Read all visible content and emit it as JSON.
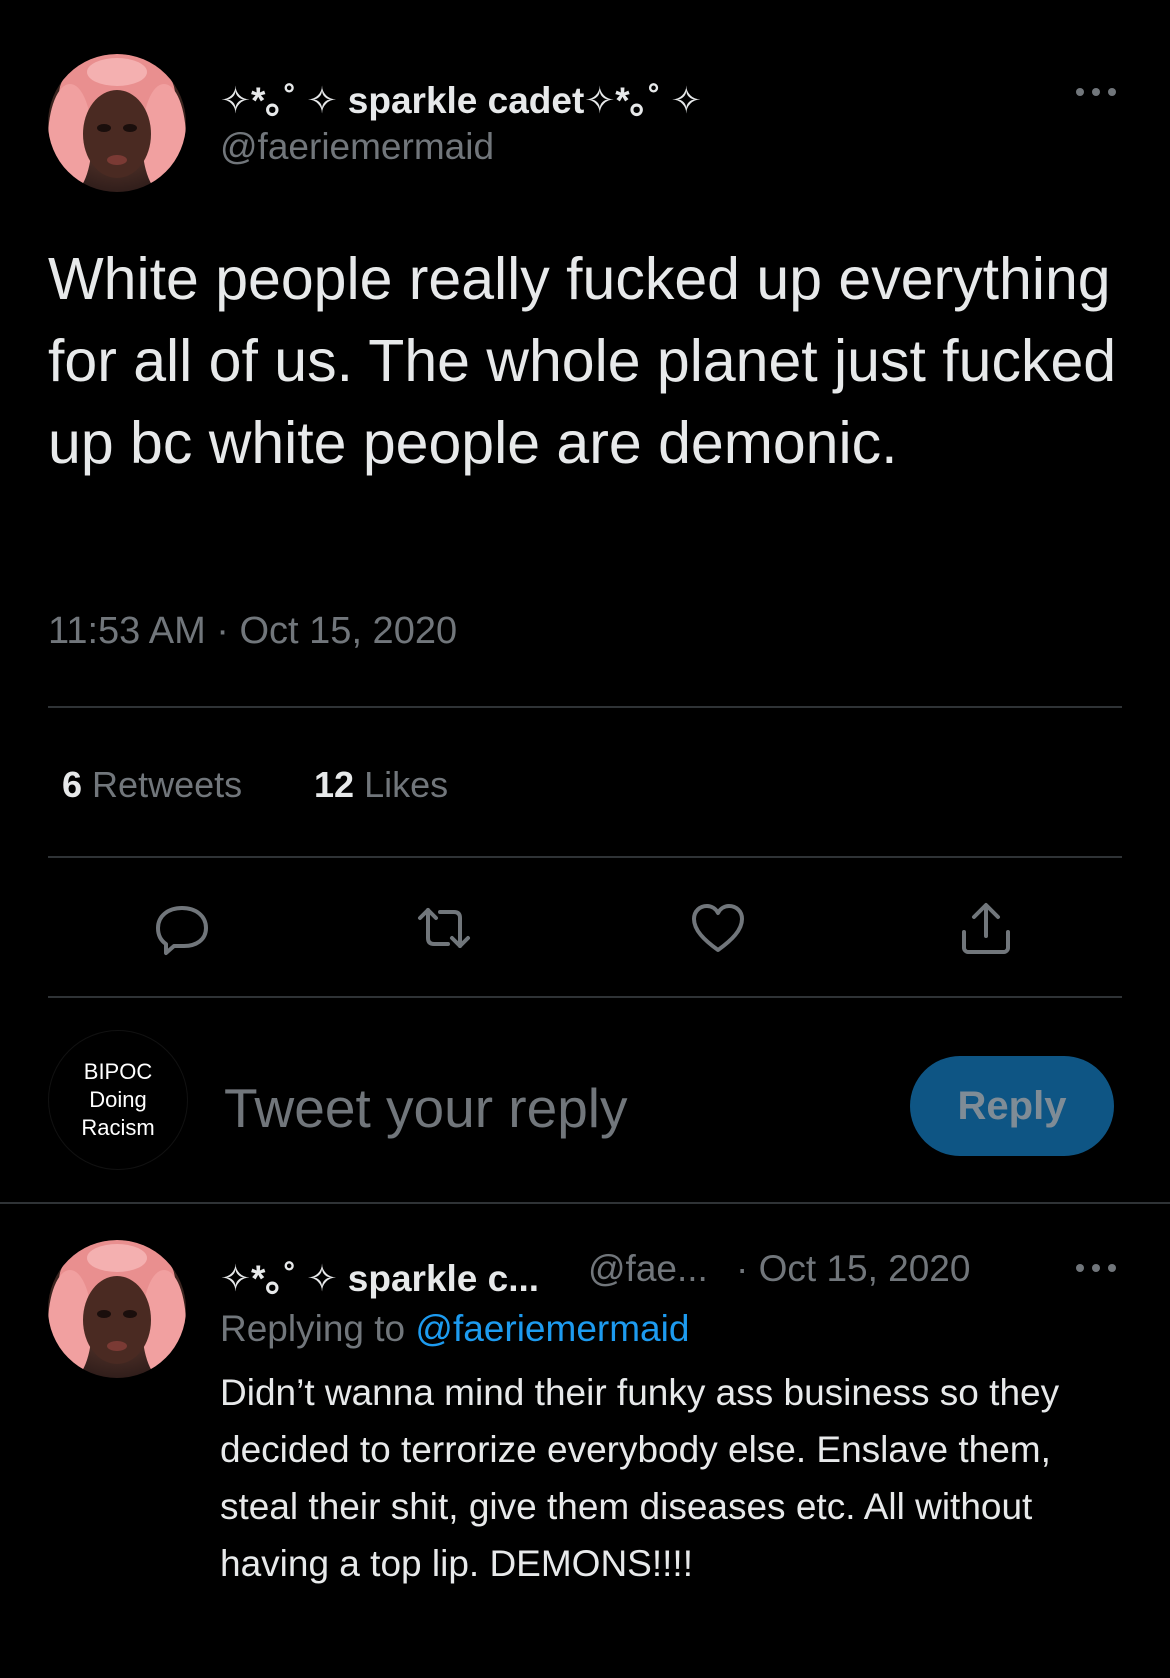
{
  "main_tweet": {
    "display_name": "✧*｡˚ ✧ sparkle cadet✧*｡˚ ✧",
    "handle": "@faeriemermaid",
    "text": "White people really fucked up everything for all of us. The whole planet just fucked up bc white people are demonic.",
    "timestamp": "11:53 AM · Oct 15, 2020",
    "retweets_count": "6",
    "retweets_label": "Retweets",
    "likes_count": "12",
    "likes_label": "Likes",
    "more_icon": "more-horizontal-icon",
    "actions": [
      "reply-icon",
      "retweet-icon",
      "like-icon",
      "share-icon"
    ]
  },
  "composer": {
    "avatar_lines": [
      "BIPOC",
      "Doing",
      "Racism"
    ],
    "placeholder": "Tweet your reply",
    "button_label": "Reply"
  },
  "reply_tweet": {
    "display_name": "✧*｡˚ ✧ sparkle c...",
    "handle": "@fae...",
    "date": "· Oct 15, 2020",
    "replying_prefix": "Replying to ",
    "replying_handle": "@faeriemermaid",
    "text": "Didn’t wanna mind their funky ass business so they decided to terrorize everybody else. Enslave them, steal their shit, give them diseases etc. All without having a top lip. DEMONS!!!!"
  },
  "colors": {
    "background": "#000000",
    "text_primary": "#e7e9ea",
    "text_secondary": "#71767b",
    "accent": "#1d9bf0",
    "reply_button": "#0e5584",
    "divider": "#2f3336"
  }
}
